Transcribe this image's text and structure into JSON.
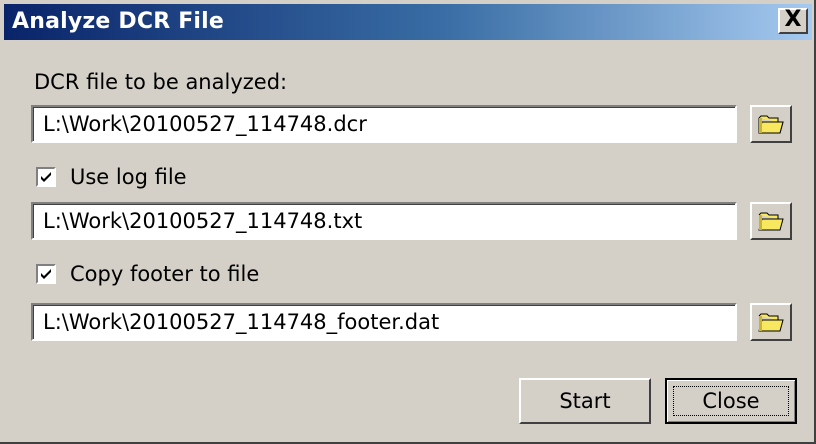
{
  "window": {
    "title": "Analyze DCR File",
    "close_glyph": "X"
  },
  "dcr": {
    "label": "DCR file to be analyzed:",
    "path": "L:\\Work\\20100527_114748.dcr",
    "browse_icon": "folder-icon"
  },
  "log": {
    "label": "Use log file",
    "checked": true,
    "path": "L:\\Work\\20100527_114748.txt",
    "browse_icon": "folder-icon"
  },
  "footer": {
    "label": "Copy footer to file",
    "checked": true,
    "path": "L:\\Work\\20100527_114748_footer.dat",
    "browse_icon": "folder-icon"
  },
  "buttons": {
    "start_label": "Start",
    "close_label": "Close"
  },
  "colors": {
    "title_gradient_start": "#0a246a",
    "title_gradient_end": "#a6caf0",
    "face": "#d4d0c8",
    "folder_yellow": "#f8e860"
  }
}
